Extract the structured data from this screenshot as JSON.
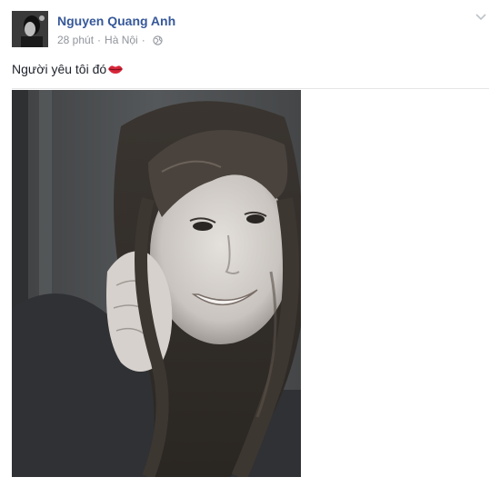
{
  "post": {
    "author_name": "Nguyen Quang Anh",
    "timestamp": "28 phút",
    "separator": "·",
    "location": "Hà Nội",
    "privacy_icon": "globe-icon",
    "options_icon": "chevron-down-icon",
    "text": "Người yêu tôi đó",
    "emoji_icon": "lips-icon",
    "photo_description_icon": "photo"
  },
  "colors": {
    "author_link": "#365899",
    "meta_text": "#90949c",
    "body_text": "#1d2129",
    "emoji": "#d8263a"
  }
}
